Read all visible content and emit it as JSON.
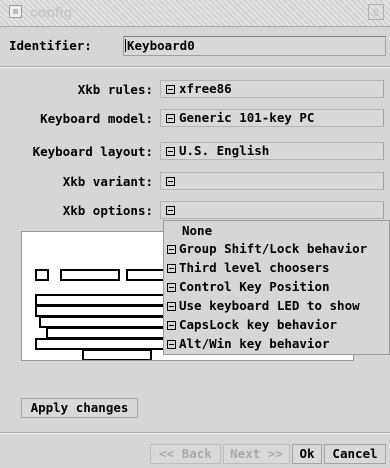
{
  "window": {
    "title": "config"
  },
  "identifier": {
    "label": "Identifier:",
    "value": "Keyboard0"
  },
  "fields": [
    {
      "label": "Xkb rules:",
      "value": "xfree86"
    },
    {
      "label": "Keyboard model:",
      "value": "Generic 101-key PC"
    },
    {
      "label": "Keyboard layout:",
      "value": "U.S. English"
    },
    {
      "label": "Xkb variant:",
      "value": ""
    },
    {
      "label": "Xkb options:",
      "value": ""
    }
  ],
  "options_menu": {
    "header": "None",
    "items": [
      "Group Shift/Lock behavior",
      "Third level choosers",
      "Control Key Position",
      "Use keyboard LED to show",
      "CapsLock key behavior",
      "Alt/Win key behavior"
    ]
  },
  "buttons": {
    "apply": "Apply changes",
    "back": "<< Back",
    "next": "Next >>",
    "ok": "Ok",
    "cancel": "Cancel"
  }
}
